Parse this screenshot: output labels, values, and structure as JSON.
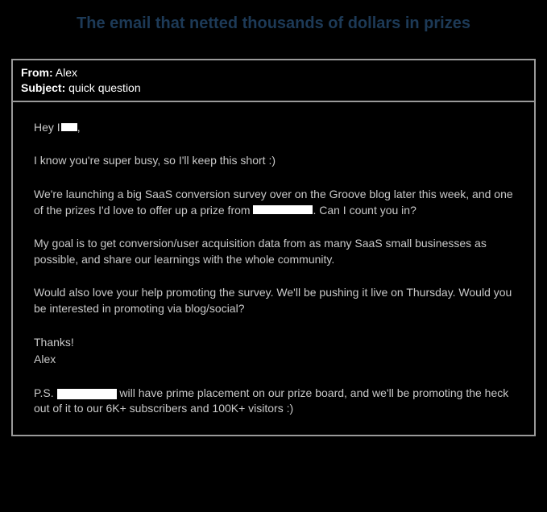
{
  "title": "The email that netted thousands of dollars in prizes",
  "header": {
    "from_label": "From:",
    "from_value": "Alex",
    "subject_label": "Subject:",
    "subject_value": "quick question"
  },
  "body": {
    "greeting_prefix": "Hey I",
    "greeting_suffix": ",",
    "p1": "I know you're super busy, so I'll keep this short :)",
    "p2_a": "We're launching a big SaaS conversion survey over on the Groove blog later this week, and one of the prizes I'd love to offer up a prize from ",
    "p2_b": ". Can I count you in?",
    "p3": "My goal is to get conversion/user acquisition data from as many SaaS small businesses as possible, and share our learnings with the whole community.",
    "p4": "Would also love your help promoting the survey. We'll be pushing it live on Thursday. Would you be interested in promoting via blog/social?",
    "thanks": "Thanks!",
    "sig": "Alex",
    "ps_a": "P.S. ",
    "ps_b": " will have prime placement on our prize board, and we'll be promoting the heck out of it to our 6K+ subscribers and 100K+ visitors :)"
  }
}
